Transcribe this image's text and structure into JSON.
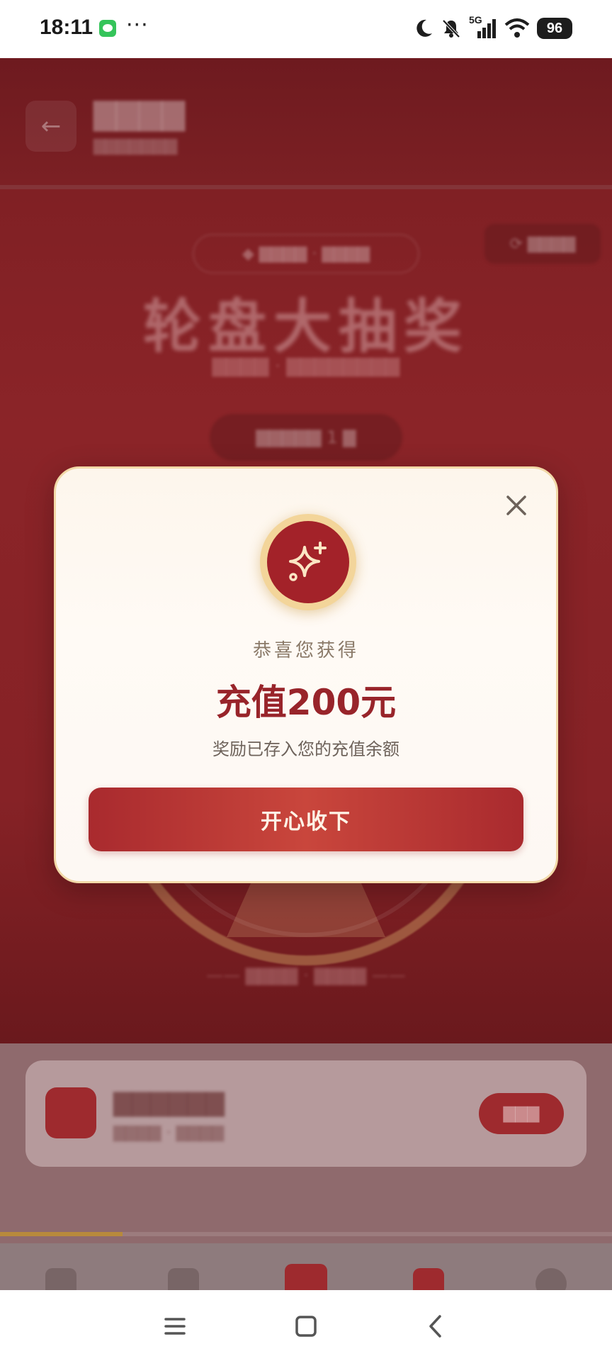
{
  "status_bar": {
    "time": "18:11",
    "dots": "···",
    "network": "5G",
    "battery": "96",
    "icons": [
      "wechat-icon",
      "moon-icon",
      "bell-off-icon",
      "signal-icon",
      "wifi-icon",
      "battery-icon"
    ]
  },
  "colors": {
    "accent": "#a32229",
    "gold": "#f3d59a",
    "modal_bg": "#fdf8f3"
  },
  "modal": {
    "congrats_text": "恭喜您获得",
    "prize_text": "充值200元",
    "description": "奖励已存入您的充值余额",
    "accept_button": "开心收下",
    "icon": "sparkle-icon",
    "close_icon": "close-icon"
  },
  "background_app": {
    "big_title": "轮盘大抽奖"
  },
  "nav_bar": {
    "icons": [
      "menu-icon",
      "home-icon",
      "back-icon"
    ]
  }
}
